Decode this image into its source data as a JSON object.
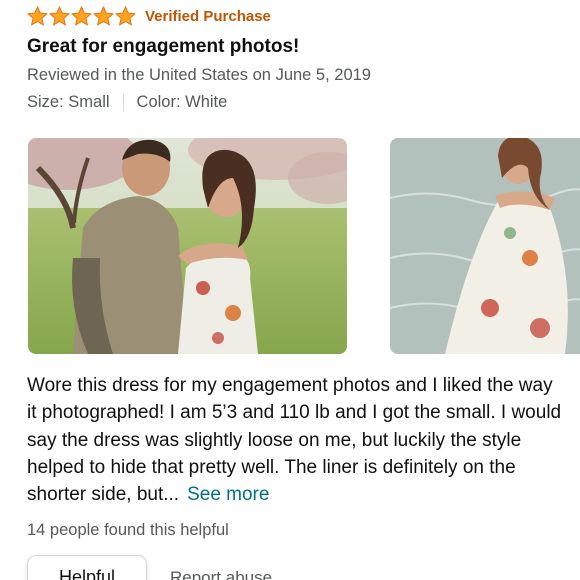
{
  "review": {
    "rating": 5,
    "rating_max": 5,
    "star_color": "#ffa41c",
    "verified_label": "Verified Purchase",
    "verified_color": "#c45500",
    "title": "Great for engagement photos!",
    "reviewed_line": "Reviewed in the United States on June 5, 2019",
    "size_label": "Size: Small",
    "color_label": "Color: White",
    "body": "Wore this dress for my engagement photos and I liked the way it photographed! I am 5’3 and 110 lb and I got the small. I would say the dress was slightly loose on me, but luckily the style helped to hide that pretty well. The liner is definitely on the shorter side, but...",
    "see_more_label": "See more",
    "link_color": "#007185",
    "helpful_count_text": "14 people found this helpful",
    "helpful_button_label": "Helpful",
    "report_label": "Report abuse"
  },
  "photos": [
    {
      "description_icon": "customer-photo-couple"
    },
    {
      "description_icon": "customer-photo-dress-lakeside"
    }
  ]
}
